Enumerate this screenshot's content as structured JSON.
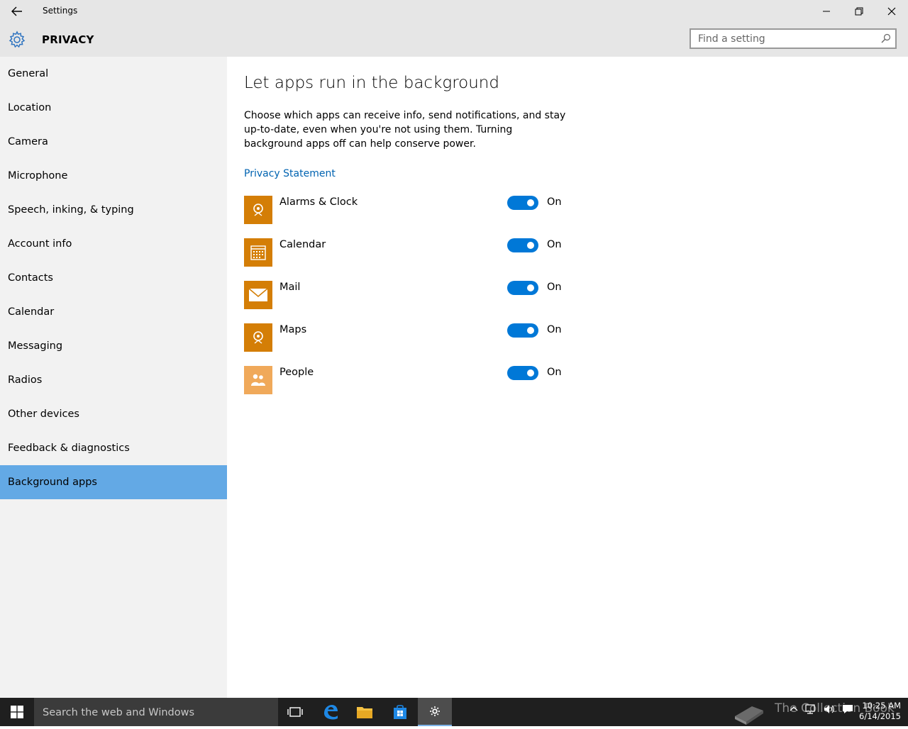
{
  "window": {
    "title": "Settings",
    "section_title": "PRIVACY",
    "search_placeholder": "Find a setting"
  },
  "sidebar": {
    "items": [
      {
        "label": "General"
      },
      {
        "label": "Location"
      },
      {
        "label": "Camera"
      },
      {
        "label": "Microphone"
      },
      {
        "label": "Speech, inking, & typing"
      },
      {
        "label": "Account info"
      },
      {
        "label": "Contacts"
      },
      {
        "label": "Calendar"
      },
      {
        "label": "Messaging"
      },
      {
        "label": "Radios"
      },
      {
        "label": "Other devices"
      },
      {
        "label": "Feedback & diagnostics"
      },
      {
        "label": "Background apps",
        "selected": true
      }
    ]
  },
  "main": {
    "title": "Let apps run in the background",
    "description": "Choose which apps can receive info, send notifications, and stay up-to-date, even when you're not using them. Turning background apps off can help conserve power.",
    "privacy_link": "Privacy Statement",
    "apps": [
      {
        "name": "Alarms & Clock",
        "state": "On",
        "icon": "alarms-clock-icon",
        "color": "#d47e06"
      },
      {
        "name": "Calendar",
        "state": "On",
        "icon": "calendar-icon",
        "color": "#d47e06"
      },
      {
        "name": "Mail",
        "state": "On",
        "icon": "mail-icon",
        "color": "#d47e06"
      },
      {
        "name": "Maps",
        "state": "On",
        "icon": "maps-icon",
        "color": "#d47e06"
      },
      {
        "name": "People",
        "state": "On",
        "icon": "people-icon",
        "color": "#f0a95a"
      }
    ]
  },
  "taskbar": {
    "search_placeholder": "Search the web and Windows",
    "watermark": "The Collection Book",
    "time": "10:25 AM",
    "date": "6/14/2015"
  },
  "colors": {
    "accent": "#0078d7",
    "selection": "#63a9e5",
    "link": "#0063b1",
    "app_tile": "#d47e06"
  }
}
